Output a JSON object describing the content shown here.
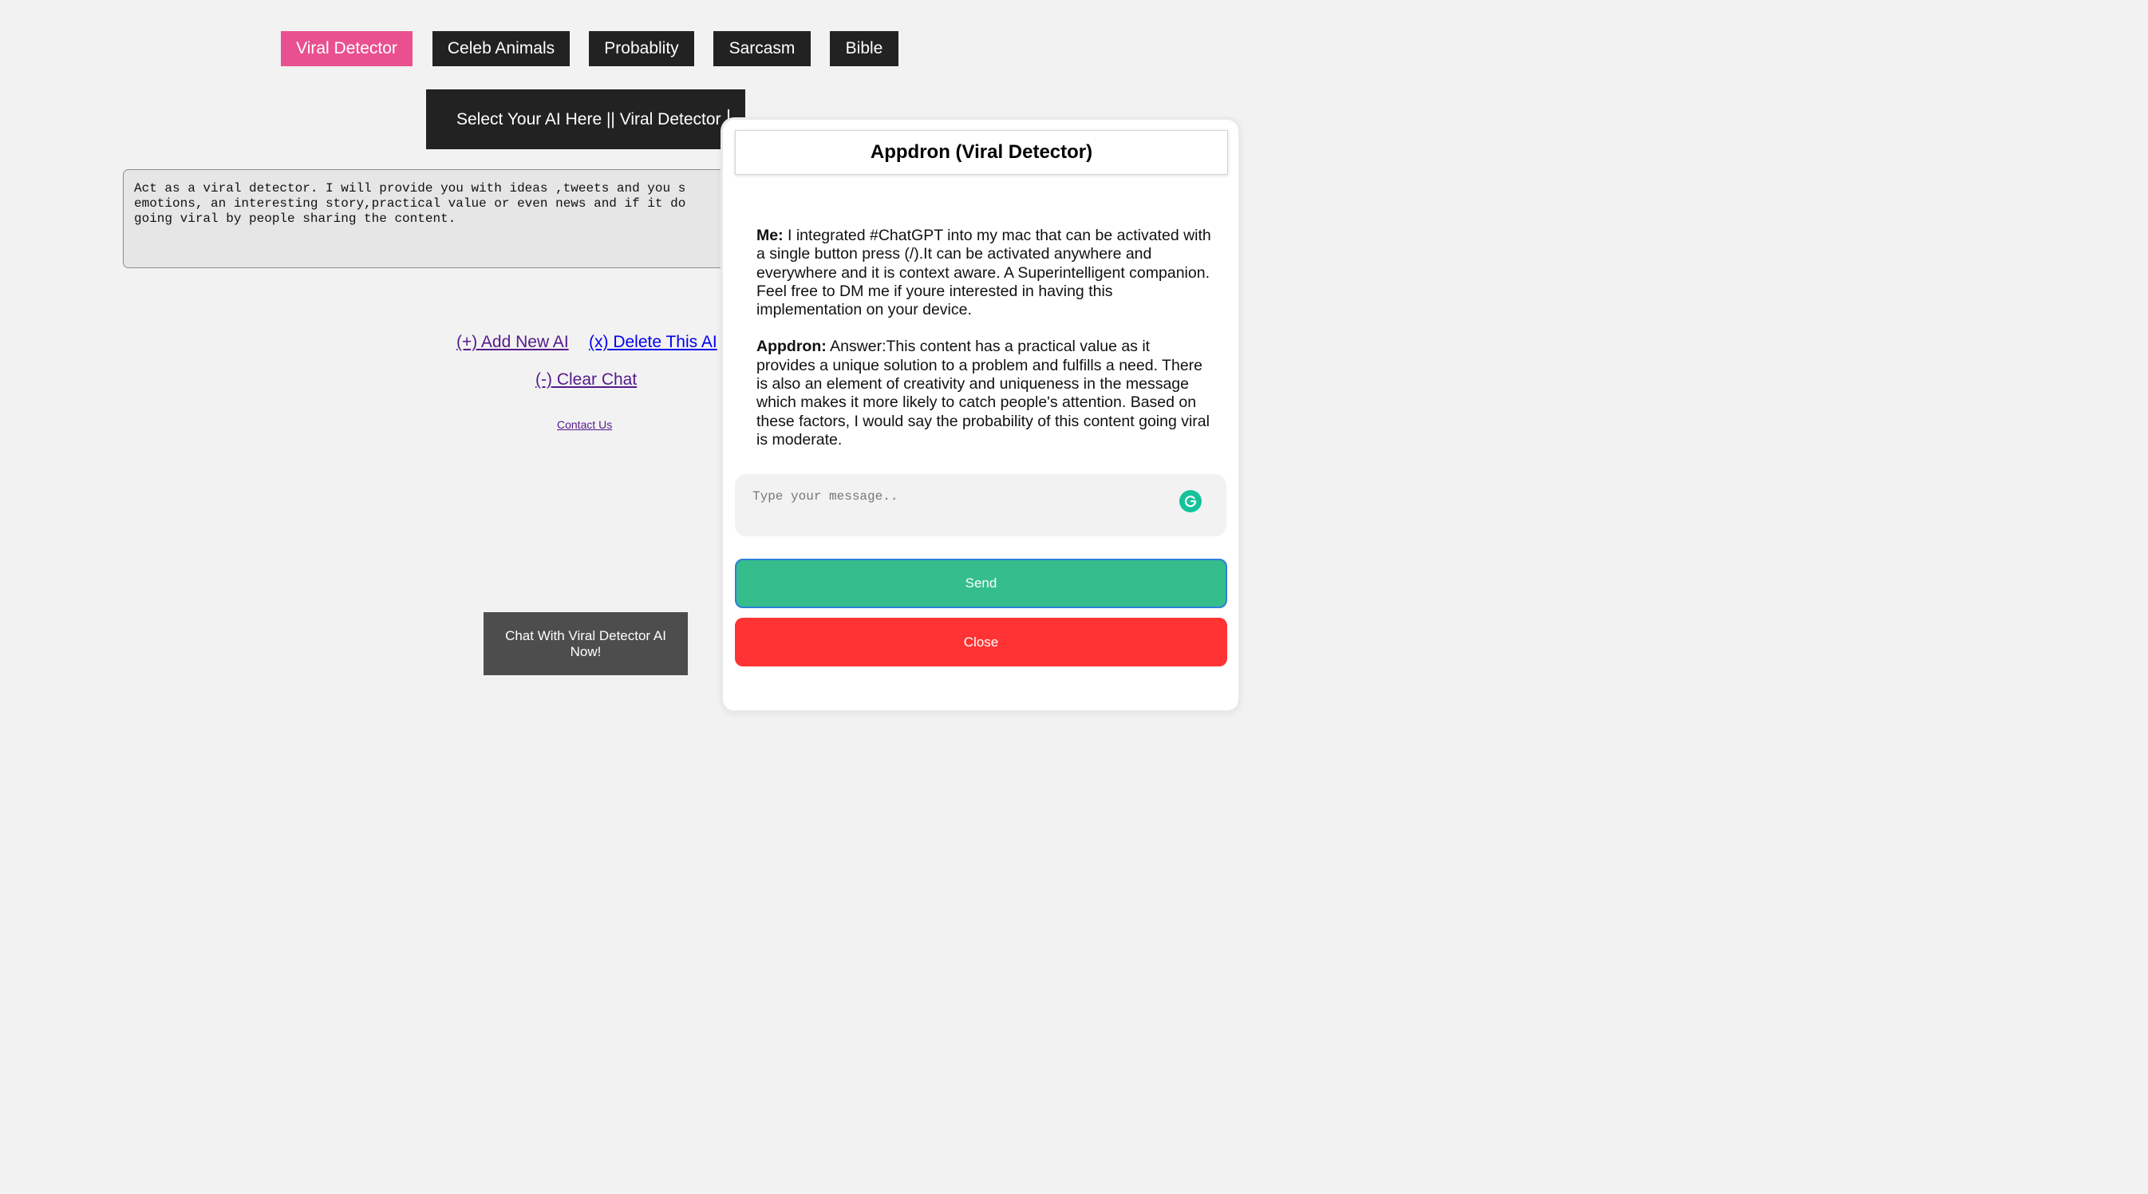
{
  "tabs": [
    {
      "label": "Viral Detector",
      "active": true
    },
    {
      "label": "Celeb Animals",
      "active": false
    },
    {
      "label": "Probablity",
      "active": false
    },
    {
      "label": "Sarcasm",
      "active": false
    },
    {
      "label": "Bible",
      "active": false
    }
  ],
  "ai_select": {
    "label": "Select Your AI Here || Viral Detector"
  },
  "prompt": {
    "text": "Act as a viral detector. I will provide you with ideas ,tweets and you s\nemotions, an interesting story,practical value or even news and if it do\ngoing viral by people sharing the content."
  },
  "actions": {
    "add_ai": "(+) Add New AI ",
    "delete_ai": "(x) Delete This AI",
    "clear_chat": "(-) Clear Chat",
    "contact": "Contact Us"
  },
  "chat_now_button": "Chat With Viral Detector AI Now!",
  "chat": {
    "title": "Appdron (Viral Detector)",
    "messages": [
      {
        "sender": "Me:",
        "text": "I integrated #ChatGPT into my mac that can be activated with a single button press (/).It can be activated anywhere and everywhere and it is context aware. A Superintelligent companion. Feel free to DM me if youre interested in having this implementation on your device."
      },
      {
        "sender": "Appdron:",
        "text": "Answer:This content has a practical value as it provides a unique solution to a problem and fulfills a need. There is also an element of creativity and uniqueness in the message which makes it more likely to catch people's attention. Based on these factors, I would say the probability of this content going viral is moderate."
      }
    ],
    "input_placeholder": "Type your message..",
    "send_label": "Send",
    "close_label": "Close"
  },
  "colors": {
    "active_tab": "#e9508f",
    "tab": "#222222",
    "send": "#35be8b",
    "close": "#ff3333",
    "grammarly": "#15c39a"
  }
}
